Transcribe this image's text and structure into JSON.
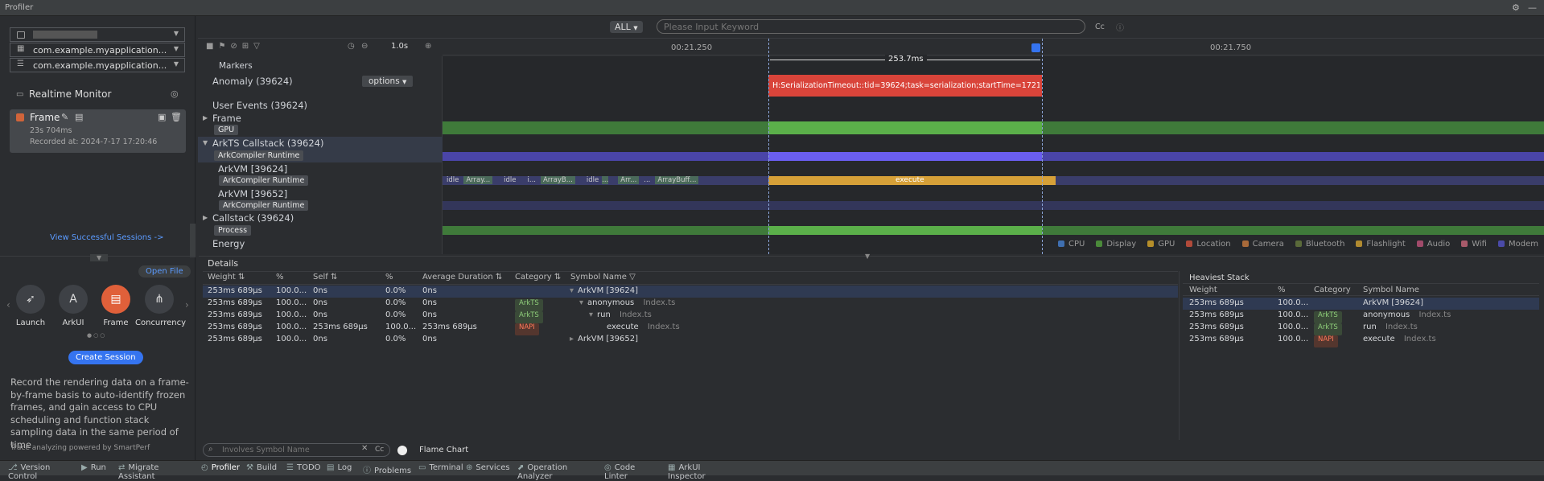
{
  "window": {
    "title": "Profiler"
  },
  "left": {
    "device_value": "",
    "app1": "com.example.myapplication...",
    "app2": "com.example.myapplication...",
    "realtime_label": "Realtime Monitor",
    "session": {
      "name": "Frame",
      "duration": "23s 704ms",
      "recorded": "Recorded at: 2024-7-17 17:20:46"
    },
    "view_sessions": "View Successful Sessions ->",
    "open_file": "Open File",
    "tools": [
      {
        "label": "Launch",
        "icon": "rocket-icon",
        "glyph": "➶"
      },
      {
        "label": "ArkUI",
        "icon": "arkui-icon",
        "glyph": "A"
      },
      {
        "label": "Frame",
        "icon": "frame-icon",
        "glyph": "▤"
      },
      {
        "label": "Concurrency",
        "icon": "concurrency-icon",
        "glyph": "⋔"
      }
    ],
    "create_session": "Create Session",
    "description": "Record the rendering data on a frame-by-frame basis to auto-identify frozen frames, and gain access to CPU scheduling and function stack sampling data in the same period of time",
    "powered_by": "Trace analyzing powered by SmartPerf"
  },
  "toolbar": {
    "filter_all": "ALL",
    "search_placeholder": "Please Input Keyword",
    "cc": "Cc",
    "zoom": "1.0s"
  },
  "timeline": {
    "ticks": [
      "00:21.250",
      "00:21.750"
    ],
    "selection": "253.7ms",
    "rows": {
      "markers": "Markers",
      "anomaly": "Anomaly (39624)",
      "options": "options",
      "user_events": "User Events (39624)",
      "frame": "Frame",
      "gpu_tag": "GPU",
      "arkts": "ArkTS Callstack (39624)",
      "arkts_tag": "ArkCompiler Runtime",
      "arkvm1": "ArkVM [39624]",
      "arkvm1_tag": "ArkCompiler Runtime",
      "arkvm2": "ArkVM [39652]",
      "arkvm2_tag": "ArkCompiler Runtime",
      "callstack": "Callstack (39624)",
      "process_tag": "Process",
      "energy": "Energy"
    },
    "anomaly_text": "H:SerializationTimeout::tid=39624;task=serialization;startTime=1721...",
    "execute_label": "execute",
    "slices": [
      "idle",
      "Array...",
      "idle",
      "i...",
      "ArrayB...",
      "idle",
      "...",
      "Arr...",
      "...",
      "ArrayBuff..."
    ],
    "legend": [
      {
        "label": "CPU",
        "color": "#3f6fb0"
      },
      {
        "label": "Display",
        "color": "#4a8a3a"
      },
      {
        "label": "GPU",
        "color": "#b58e2a"
      },
      {
        "label": "Location",
        "color": "#b04a3a"
      },
      {
        "label": "Camera",
        "color": "#a86a3a"
      },
      {
        "label": "Bluetooth",
        "color": "#5a6a3a"
      },
      {
        "label": "Flashlight",
        "color": "#b08a30"
      },
      {
        "label": "Audio",
        "color": "#a04a6a"
      },
      {
        "label": "Wifi",
        "color": "#a85a6a"
      },
      {
        "label": "Modem",
        "color": "#4a4aa8"
      }
    ]
  },
  "details": {
    "title": "Details",
    "columns": [
      "Weight",
      "%",
      "Self",
      "%",
      "Average Duration",
      "Category",
      "Symbol Name"
    ],
    "rows": [
      {
        "weight": "253ms 689μs",
        "pct": "100.0...",
        "self": "0ns",
        "spct": "0.0%",
        "avg": "0ns",
        "cat": "",
        "sym": "ArkVM [39624]",
        "file": "",
        "indent": 0,
        "arrow": "▾"
      },
      {
        "weight": "253ms 689μs",
        "pct": "100.0...",
        "self": "0ns",
        "spct": "0.0%",
        "avg": "0ns",
        "cat": "ArkTS",
        "sym": "anonymous",
        "file": "Index.ts",
        "indent": 1,
        "arrow": "▾"
      },
      {
        "weight": "253ms 689μs",
        "pct": "100.0...",
        "self": "0ns",
        "spct": "0.0%",
        "avg": "0ns",
        "cat": "ArkTS",
        "sym": "run",
        "file": "Index.ts",
        "indent": 2,
        "arrow": "▾"
      },
      {
        "weight": "253ms 689μs",
        "pct": "100.0...",
        "self": "253ms 689μs",
        "spct": "100.0...",
        "avg": "253ms 689μs",
        "cat": "NAPI",
        "sym": "execute",
        "file": "Index.ts",
        "indent": 3,
        "arrow": ""
      },
      {
        "weight": "253ms 689μs",
        "pct": "100.0...",
        "self": "0ns",
        "spct": "0.0%",
        "avg": "0ns",
        "cat": "",
        "sym": "ArkVM [39652]",
        "file": "",
        "indent": 0,
        "arrow": "▸"
      }
    ],
    "heaviest": {
      "title": "Heaviest Stack",
      "columns": [
        "Weight",
        "%",
        "Category",
        "Symbol Name"
      ],
      "rows": [
        {
          "weight": "253ms 689μs",
          "pct": "100.0...",
          "cat": "",
          "sym": "ArkVM [39624]",
          "file": ""
        },
        {
          "weight": "253ms 689μs",
          "pct": "100.0...",
          "cat": "ArkTS",
          "sym": "anonymous",
          "file": "Index.ts"
        },
        {
          "weight": "253ms 689μs",
          "pct": "100.0...",
          "cat": "ArkTS",
          "sym": "run",
          "file": "Index.ts"
        },
        {
          "weight": "253ms 689μs",
          "pct": "100.0...",
          "cat": "NAPI",
          "sym": "execute",
          "file": "Index.ts"
        }
      ]
    },
    "filter_placeholder": "Involves Symbol Name",
    "filter_cc": "Cc",
    "flame_chart": "Flame Chart"
  },
  "bottombar": [
    "Version Control",
    "Run",
    "Migrate Assistant",
    "Profiler",
    "Build",
    "TODO",
    "Log",
    "Problems",
    "Terminal",
    "Services",
    "Operation Analyzer",
    "Code Linter",
    "ArkUI Inspector"
  ]
}
